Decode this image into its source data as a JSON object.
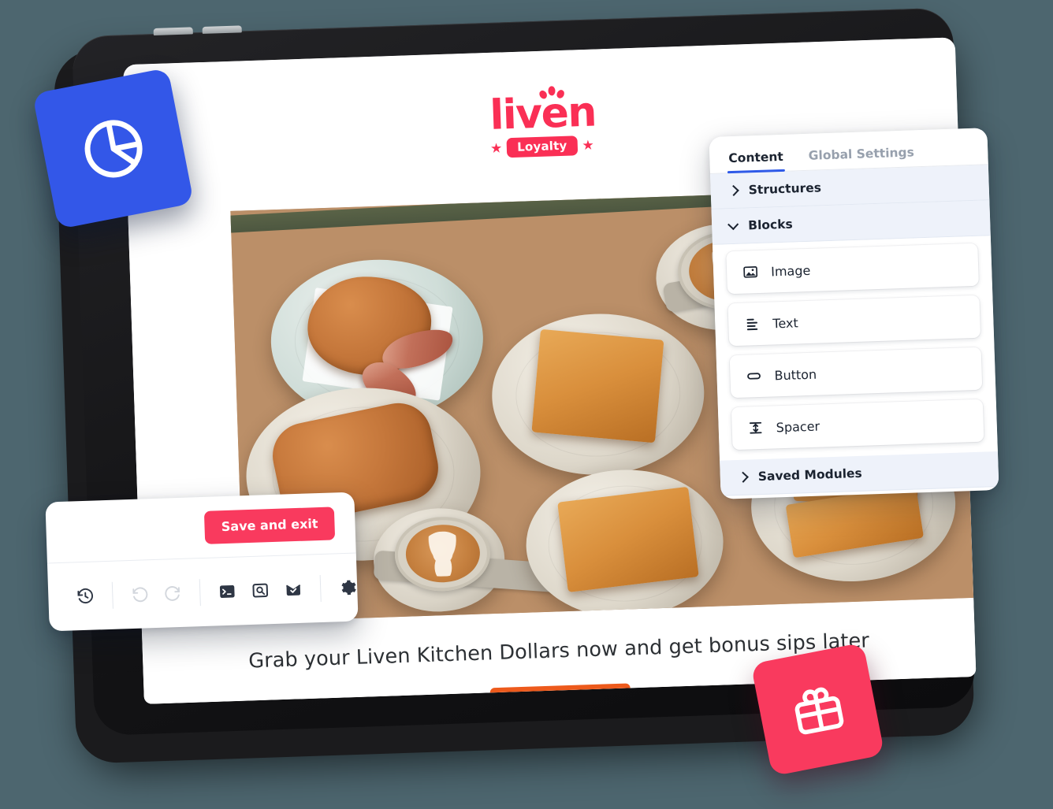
{
  "background_color": "#4d666f",
  "device": {
    "name": "tablet-device",
    "volume_buttons": 2,
    "power_button": 1
  },
  "email_preview": {
    "logo": {
      "wordmark": "liven",
      "badge_text": "Loyalty",
      "star_glyph": "★",
      "color": "#fa2f55"
    },
    "hero_image_alt": "cafe table with sandwiches, toasties and lattes",
    "caption": "Grab your Liven Kitchen Dollars now and get bonus sips later",
    "cta_color": "#ed5a1c"
  },
  "content_panel": {
    "tabs": [
      {
        "label": "Content",
        "active": true
      },
      {
        "label": "Global Settings",
        "active": false
      }
    ],
    "active_tab_underline_color": "#2f5ae8",
    "sections": [
      {
        "label": "Structures",
        "expanded": false,
        "chevron": "chevron-right-icon"
      },
      {
        "label": "Blocks",
        "expanded": true,
        "chevron": "chevron-down-icon"
      },
      {
        "label": "Saved Modules",
        "expanded": false,
        "chevron": "chevron-right-icon"
      }
    ],
    "blocks": [
      {
        "label": "Image",
        "icon": "image-icon"
      },
      {
        "label": "Text",
        "icon": "text-lines-icon"
      },
      {
        "label": "Button",
        "icon": "button-pill-icon"
      },
      {
        "label": "Spacer",
        "icon": "spacer-arrows-icon"
      }
    ]
  },
  "toolbar": {
    "save_label": "Save and exit",
    "save_color": "#f93a5e",
    "actions": [
      {
        "name": "version-history-icon",
        "label": "Version history",
        "disabled": false
      },
      {
        "name": "undo-icon",
        "label": "Undo",
        "disabled": true
      },
      {
        "name": "redo-icon",
        "label": "Redo",
        "disabled": true
      },
      {
        "name": "code-terminal-icon",
        "label": "Code",
        "disabled": false
      },
      {
        "name": "preview-icon",
        "label": "Preview",
        "disabled": false
      },
      {
        "name": "test-email-icon",
        "label": "Send test email",
        "disabled": false
      },
      {
        "name": "settings-gear-icon",
        "label": "Settings",
        "disabled": false
      }
    ]
  },
  "badges": [
    {
      "name": "analytics-badge",
      "icon": "pie-chart-icon",
      "color": "#3357e8"
    },
    {
      "name": "rewards-badge",
      "icon": "gift-icon",
      "color": "#f93a5e"
    }
  ]
}
